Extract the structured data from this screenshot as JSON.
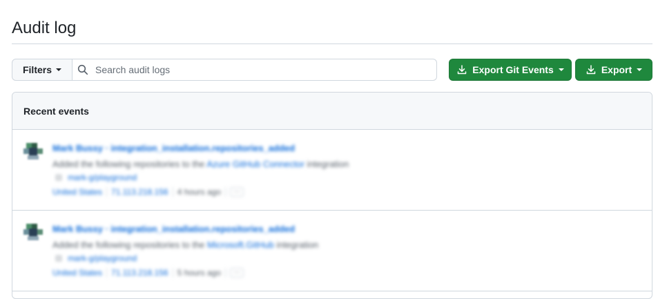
{
  "header": {
    "title": "Audit log"
  },
  "toolbar": {
    "filters_label": "Filters",
    "search_placeholder": "Search audit logs",
    "search_value": "",
    "export_git_label": "Export Git Events",
    "export_label": "Export"
  },
  "events_panel": {
    "header": "Recent events",
    "events": [
      {
        "title": "Mark Bussy · integration_installation.repositories_added",
        "description": "Added the following repositories to the ",
        "description_link": "Azure GitHub Connector",
        "description_tail": " integration",
        "repo": "mark-g/playground",
        "location": "United States",
        "ip": "71.113.218.156",
        "time": "4 hours ago"
      },
      {
        "title": "Mark Bussy · integration_installation.repositories_added",
        "description": "Added the following repositories to the ",
        "description_link": "Microsoft.GitHub",
        "description_tail": " integration",
        "repo": "mark-g/playground",
        "location": "United States",
        "ip": "71.113.218.156",
        "time": "5 hours ago"
      }
    ]
  },
  "icons": {
    "filters_caret": "caret-down-icon",
    "search": "search-icon",
    "download": "download-icon",
    "repo": "repo-icon",
    "more": "kebab-icon"
  },
  "colors": {
    "primary_button": "#1f883d",
    "link": "#0969da",
    "border": "#d0d7de",
    "header_bg": "#f6f8fa"
  }
}
